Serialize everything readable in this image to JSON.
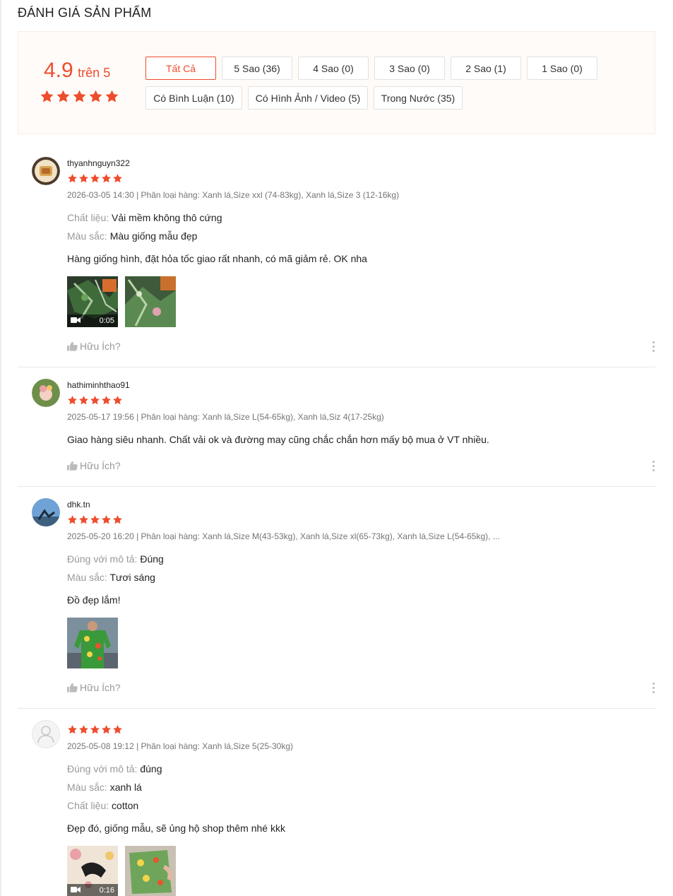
{
  "header": {
    "title": "ĐÁNH GIÁ SẢN PHẨM"
  },
  "summary": {
    "score": "4.9",
    "score_suffix": "trên 5",
    "rating_stars": 5,
    "star_color": "#ee4d2d"
  },
  "filters": [
    {
      "label": "Tất Cả",
      "active": true
    },
    {
      "label": "5 Sao (36)"
    },
    {
      "label": "4 Sao (0)"
    },
    {
      "label": "3 Sao (0)"
    },
    {
      "label": "2 Sao (1)"
    },
    {
      "label": "1 Sao (0)"
    },
    {
      "label": "Có Bình Luận (10)"
    },
    {
      "label": "Có Hình Ảnh / Video (5)"
    },
    {
      "label": "Trong Nước (35)"
    }
  ],
  "helpful_label": "Hữu Ích?",
  "reviews": [
    {
      "username": "thyanhnguyn322",
      "stars": 5,
      "meta": "2026-03-05 14:30 | Phân loại hàng: Xanh lá,Size xxl (74-83kg), Xanh lá,Size 3 (12-16kg)",
      "attributes": [
        {
          "key": "Chất liệu:",
          "value": "Vải mềm không thô cứng"
        },
        {
          "key": "Màu sắc:",
          "value": "Màu giống mẫu đẹp"
        }
      ],
      "comment": "Hàng giống hình, đặt hỏa tốc giao rất nhanh, có mã giảm rẻ. OK nha",
      "media": [
        {
          "type": "video",
          "duration": "0:05",
          "icon": "video-camera-icon"
        },
        {
          "type": "image"
        }
      ]
    },
    {
      "username": "hathiminhthao91",
      "stars": 5,
      "meta": "2025-05-17 19:56 | Phân loại hàng: Xanh lá,Size L(54-65kg), Xanh lá,Siz 4(17-25kg)",
      "attributes": [],
      "comment": "Giao hàng siêu nhanh. Chất vải ok và đường may cũng chắc chắn hơn mấy bộ mua ở VT nhiều.",
      "media": []
    },
    {
      "username": "dhk.tn",
      "stars": 5,
      "meta": "2025-05-20 16:20 | Phân loại hàng: Xanh lá,Size M(43-53kg), Xanh lá,Size xl(65-73kg), Xanh lá,Size L(54-65kg), ...",
      "attributes": [
        {
          "key": "Đúng với mô tả:",
          "value": "Đúng"
        },
        {
          "key": "Màu sắc:",
          "value": "Tươi sáng"
        }
      ],
      "comment": "Đồ đẹp lắm!",
      "media": [
        {
          "type": "image"
        }
      ]
    },
    {
      "username": "",
      "stars": 5,
      "meta": "2025-05-08 19:12 | Phân loại hàng: Xanh lá,Size 5(25-30kg)",
      "attributes": [
        {
          "key": "Đúng với mô tả:",
          "value": "đúng"
        },
        {
          "key": "Màu sắc:",
          "value": "xanh lá"
        },
        {
          "key": "Chất liệu:",
          "value": "cotton"
        }
      ],
      "comment": "Đẹp đó, giống mẫu, sẽ ủng hộ shop thêm nhé kkk",
      "media": [
        {
          "type": "video",
          "duration": "0:16",
          "icon": "video-camera-icon"
        },
        {
          "type": "image"
        }
      ]
    }
  ]
}
